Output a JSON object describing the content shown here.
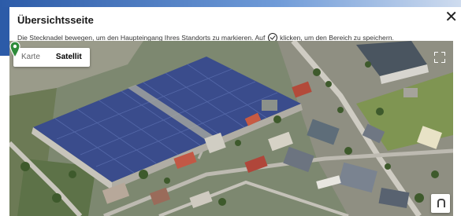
{
  "dialog": {
    "title": "Übersichtsseite",
    "close_label": "✕",
    "instruction_before": "Die Stecknadel bewegen, um den Haupteingang Ihres Standorts zu markieren. Auf",
    "instruction_after": "klicken, um den Bereich zu speichern."
  },
  "map": {
    "type_buttons": [
      "Karte",
      "Satellit"
    ],
    "selected_type": "Satellit"
  },
  "colors": {
    "header_blue": "#2c5ba8",
    "solar_roof": "#3a4c8c",
    "pin_green": "#2e8b3a"
  }
}
